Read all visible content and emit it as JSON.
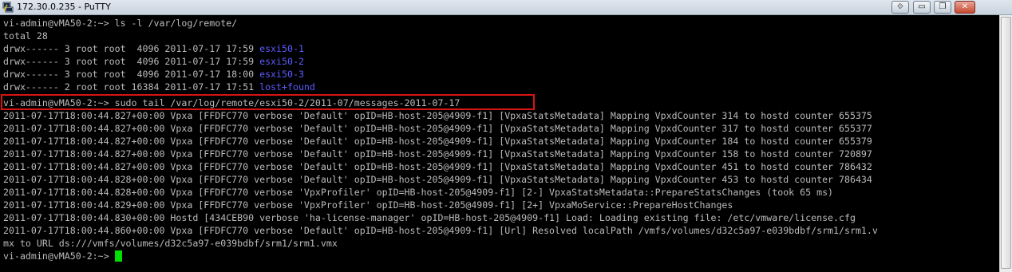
{
  "window": {
    "title": "172.30.0.235 - PuTTY",
    "controls": {
      "restore_glyph": "⟐",
      "minimize_glyph": "▭",
      "maximize_glyph": "❐",
      "close_glyph": "✕"
    }
  },
  "colors": {
    "background": "#000000",
    "text": "#bbbbbb",
    "directory": "#5c5cff",
    "cursor": "#00e000",
    "highlight_box": "#d81414"
  },
  "terminal": {
    "l0": "vi-admin@vMA50-2:~> ls -l /var/log/remote/",
    "l1": "total 28",
    "l2": {
      "meta": "drwx------ 3 root root  4096 2011-07-17 17:59 ",
      "name": "esxi50-1"
    },
    "l3": {
      "meta": "drwx------ 3 root root  4096 2011-07-17 17:59 ",
      "name": "esxi50-2"
    },
    "l4": {
      "meta": "drwx------ 3 root root  4096 2011-07-17 18:00 ",
      "name": "esxi50-3"
    },
    "l5": {
      "meta": "drwx------ 2 root root 16384 2011-07-17 17:51 ",
      "name": "lost+found"
    },
    "l6": "vi-admin@vMA50-2:~> sudo tail /var/log/remote/esxi50-2/2011-07/messages-2011-07-17",
    "l7": "2011-07-17T18:00:44.827+00:00 Vpxa [FFDFC770 verbose 'Default' opID=HB-host-205@4909-f1] [VpxaStatsMetadata] Mapping VpxdCounter 314 to hostd counter 655375",
    "l8": "2011-07-17T18:00:44.827+00:00 Vpxa [FFDFC770 verbose 'Default' opID=HB-host-205@4909-f1] [VpxaStatsMetadata] Mapping VpxdCounter 317 to hostd counter 655377",
    "l9": "2011-07-17T18:00:44.827+00:00 Vpxa [FFDFC770 verbose 'Default' opID=HB-host-205@4909-f1] [VpxaStatsMetadata] Mapping VpxdCounter 184 to hostd counter 655379",
    "l10": "2011-07-17T18:00:44.827+00:00 Vpxa [FFDFC770 verbose 'Default' opID=HB-host-205@4909-f1] [VpxaStatsMetadata] Mapping VpxdCounter 158 to hostd counter 720897",
    "l11": "2011-07-17T18:00:44.827+00:00 Vpxa [FFDFC770 verbose 'Default' opID=HB-host-205@4909-f1] [VpxaStatsMetadata] Mapping VpxdCounter 451 to hostd counter 786432",
    "l12": "2011-07-17T18:00:44.828+00:00 Vpxa [FFDFC770 verbose 'Default' opID=HB-host-205@4909-f1] [VpxaStatsMetadata] Mapping VpxdCounter 453 to hostd counter 786434",
    "l13": "2011-07-17T18:00:44.828+00:00 Vpxa [FFDFC770 verbose 'VpxProfiler' opID=HB-host-205@4909-f1] [2-] VpxaStatsMetadata::PrepareStatsChanges (took 65 ms)",
    "l14": "2011-07-17T18:00:44.829+00:00 Vpxa [FFDFC770 verbose 'VpxProfiler' opID=HB-host-205@4909-f1] [2+] VpxaMoService::PrepareHostChanges",
    "l15": "2011-07-17T18:00:44.830+00:00 Hostd [434CEB90 verbose 'ha-license-manager' opID=HB-host-205@4909-f1] Load: Loading existing file: /etc/vmware/license.cfg",
    "l16": "2011-07-17T18:00:44.860+00:00 Vpxa [FFDFC770 verbose 'Default' opID=HB-host-205@4909-f1] [Url] Resolved localPath /vmfs/volumes/d32c5a97-e039bdbf/srm1/srm1.v",
    "l17": "mx to URL ds:///vmfs/volumes/d32c5a97-e039bdbf/srm1/srm1.vmx",
    "l18": "vi-admin@vMA50-2:~> "
  }
}
